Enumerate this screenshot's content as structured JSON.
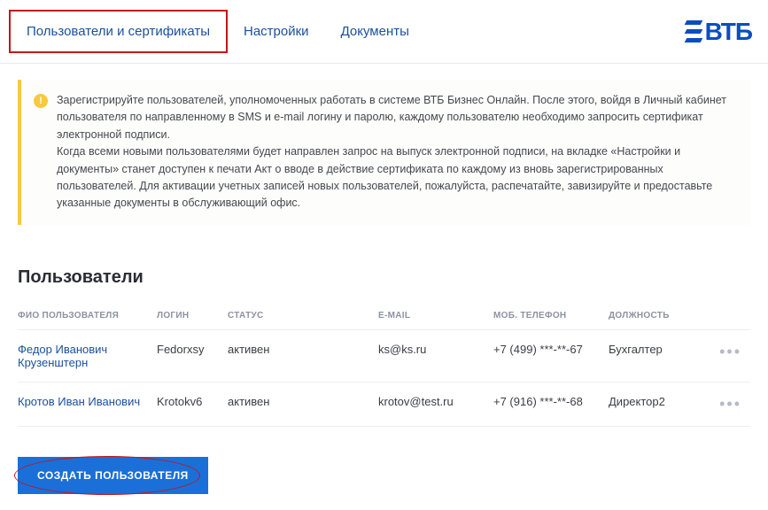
{
  "tabs": {
    "users_certs": "Пользователи и сертификаты",
    "settings": "Настройки",
    "documents": "Документы"
  },
  "logo": {
    "text": "ВТБ"
  },
  "info": {
    "text": "Зарегистрируйте пользователей, уполномоченных работать в системе ВТБ Бизнес Онлайн.  После этого, войдя в Личный кабинет пользователя по направленному в SMS и e-mail логину и паролю, каждому пользователю необходимо запросить сертификат электронной подписи.\nКогда всеми новыми пользователями будет направлен запрос на выпуск электронной подписи, на вкладке «Настройки и документы» станет доступен к печати Акт о вводе в действие сертификата по каждому из вновь зарегистрированных пользователей. Для активации учетных записей новых пользователей, пожалуйста, распечатайте, завизируйте и предоставьте указанные документы в обслуживающий офис."
  },
  "section": {
    "title": "Пользователи"
  },
  "table": {
    "headers": {
      "name": "ФИО ПОЛЬЗОВАТЕЛЯ",
      "login": "ЛОГИН",
      "status": "СТАТУС",
      "email": "E-MAIL",
      "phone": "МОБ. ТЕЛЕФОН",
      "position": "ДОЛЖНОСТЬ"
    },
    "rows": [
      {
        "name": "Федор Иванович Крузенштерн",
        "login": "Fedorxsy",
        "status": "активен",
        "email": "ks@ks.ru",
        "phone": "+7 (499) ***-**-67",
        "position": "Бухгалтер"
      },
      {
        "name": "Кротов Иван Иванович",
        "login": "Krotokv6",
        "status": "активен",
        "email": "krotov@test.ru",
        "phone": "+7 (916) ***-**-68",
        "position": "Директор2"
      }
    ]
  },
  "buttons": {
    "create_user": "СОЗДАТЬ ПОЛЬЗОВАТЕЛЯ"
  }
}
